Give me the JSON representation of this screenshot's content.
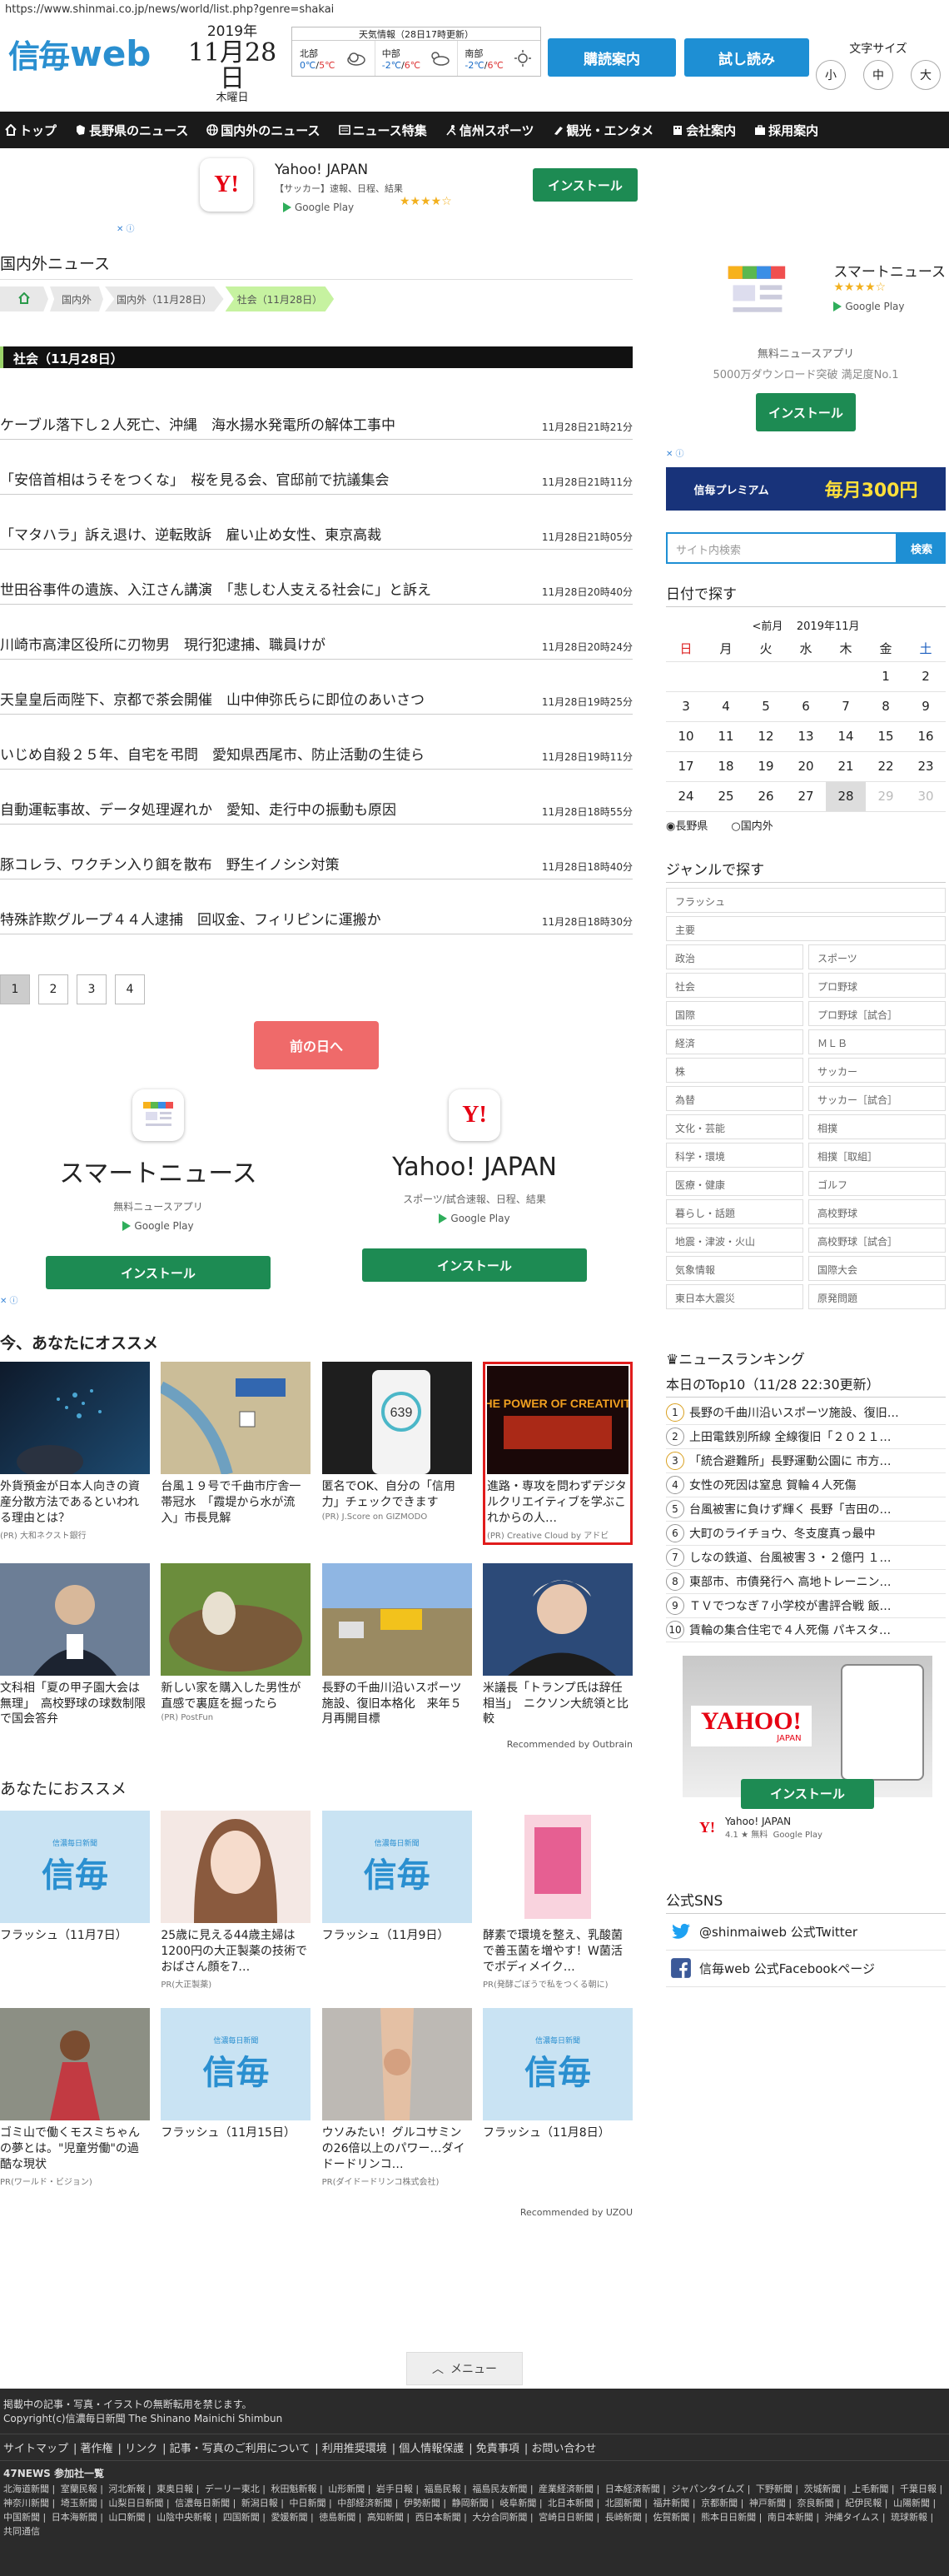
{
  "url": "https://www.shinmai.co.jp/news/world/list.php?genre=shakai",
  "header": {
    "logo_kanji": "信毎",
    "logo_web": "web",
    "year": "2019年",
    "month_day": "11月28日",
    "weekday": "木曜日",
    "weather_title": "天気情報（28日17時更新）",
    "weather": [
      {
        "area": "北部",
        "low": "0℃",
        "high": "5℃",
        "icon": "cloud-icon"
      },
      {
        "area": "中部",
        "low": "-2℃",
        "high": "6℃",
        "icon": "cloud-sun-icon"
      },
      {
        "area": "南部",
        "low": "-2℃",
        "high": "6℃",
        "icon": "sun-icon"
      }
    ],
    "subscribe_label": "購読案内",
    "trial_label": "試し読み",
    "font_size_label": "文字サイズ",
    "font_sizes": [
      "小",
      "中",
      "大"
    ],
    "brand_color": "#2a8fd0"
  },
  "nav": [
    {
      "label": "トップ",
      "icon": "home-icon"
    },
    {
      "label": "長野県のニュース",
      "icon": "map-icon"
    },
    {
      "label": "国内外のニュース",
      "icon": "globe-icon"
    },
    {
      "label": "ニュース特集",
      "icon": "newspaper-icon"
    },
    {
      "label": "信州スポーツ",
      "icon": "sports-icon"
    },
    {
      "label": "観光・エンタメ",
      "icon": "camera-icon"
    },
    {
      "label": "会社案内",
      "icon": "building-icon"
    },
    {
      "label": "採用案内",
      "icon": "briefcase-icon"
    }
  ],
  "top_ad": {
    "brand": "Yahoo! JAPAN",
    "desc": "【サッカー】速報、日程、結果",
    "stars": "★★★★☆",
    "store": "Google Play",
    "install": "インストール"
  },
  "main": {
    "section_title": "国内外ニュース",
    "breadcrumb": [
      "国内外",
      "国内外（11月28日）",
      "社会（11月28日）"
    ],
    "category_title": "社会（11月28日）",
    "news": [
      {
        "title": "ケーブル落下し２人死亡、沖縄　海水揚水発電所の解体工事中",
        "time": "11月28日21時21分"
      },
      {
        "title": "「安倍首相はうそをつくな」　桜を見る会、官邸前で抗議集会",
        "time": "11月28日21時11分"
      },
      {
        "title": "「マタハラ」訴え退け、逆転敗訴　雇い止め女性、東京高裁",
        "time": "11月28日21時05分"
      },
      {
        "title": "世田谷事件の遺族、入江さん講演　「悲しむ人支える社会に」と訴え",
        "time": "11月28日20時40分"
      },
      {
        "title": "川崎市高津区役所に刃物男　現行犯逮捕、職員けが",
        "time": "11月28日20時24分"
      },
      {
        "title": "天皇皇后両陛下、京都で茶会開催　山中伸弥氏らに即位のあいさつ",
        "time": "11月28日19時25分"
      },
      {
        "title": "いじめ自殺２５年、自宅を弔問　愛知県西尾市、防止活動の生徒ら",
        "time": "11月28日19時11分"
      },
      {
        "title": "自動運転事故、データ処理遅れか　愛知、走行中の振動も原因",
        "time": "11月28日18時55分"
      },
      {
        "title": "豚コレラ、ワクチン入り餌を散布　野生イノシシ対策",
        "time": "11月28日18時40分"
      },
      {
        "title": "特殊詐欺グループ４４人逮捕　回収金、フィリピンに運搬か",
        "time": "11月28日18時30分"
      }
    ],
    "pages": [
      "1",
      "2",
      "3",
      "4"
    ],
    "prev_day": "前の日へ",
    "dual_ad": [
      {
        "name": "スマートニュース",
        "sub": "無料ニュースアプリ",
        "store": "Google Play",
        "install": "インストール"
      },
      {
        "name": "Yahoo! JAPAN",
        "sub": "スポーツ/試合速報、日程、結果",
        "store": "Google Play",
        "install": "インストール"
      }
    ],
    "reco_title": "今、あなたにオススメ",
    "reco": [
      {
        "caption": "外貨預金が日本人向きの資産分散方法であるといわれる理由とは？",
        "source": "(PR) 大和ネクスト銀行"
      },
      {
        "caption": "台風１９号で千曲市庁舎一帯冠水　「霞堤から水が流入」市長見解",
        "source": ""
      },
      {
        "caption": "匿名でOK、自分の「信用力」チェックできます",
        "source": "(PR) J.Score on GIZMODO"
      },
      {
        "caption": "進路・専攻を問わずデジタルクリエイティブを学ぶこれからの人…",
        "source": "(PR) Creative Cloud by アドビ"
      },
      {
        "caption": "文科相「夏の甲子園大会は無理」　高校野球の球数制限で国会答弁",
        "source": ""
      },
      {
        "caption": "新しい家を購入した男性が直感で裏庭を掘ったら",
        "source": "(PR) PostFun"
      },
      {
        "caption": "長野の千曲川沿いスポーツ施設、復旧本格化　来年５月再開目標",
        "source": ""
      },
      {
        "caption": "米議長「トランプ氏は辞任相当」　ニクソン大統領と比較",
        "source": ""
      }
    ],
    "reco_banner_text": "THE POWER OF CREATIVITY",
    "reco_by": "Recommended by Outbrain",
    "reco2_title": "あなたにおススメ",
    "reco2": [
      {
        "caption": "フラッシュ（11月7日）",
        "source": "",
        "img": "web"
      },
      {
        "caption": "25歳に見える44歳主婦は1200円の大正製薬の技術でおばさん顔を7…",
        "source": "PR(大正製薬)",
        "img": "woman"
      },
      {
        "caption": "フラッシュ（11月9日）",
        "source": "",
        "img": "web"
      },
      {
        "caption": "酵素で環境を整え、乳酸菌で善玉菌を増やす！W菌活でボディメイク…",
        "source": "PR(発酵ごぼうで私をつくる朝に)",
        "img": "product"
      },
      {
        "caption": "ゴミ山で働くモスミちゃんの夢とは。\"児童労働\"の過酷な現状",
        "source": "PR(ワールド・ビジョン)",
        "img": "child"
      },
      {
        "caption": "フラッシュ（11月15日）",
        "source": "",
        "img": "web"
      },
      {
        "caption": "ウソみたい！グルコサミンの26倍以上のパワー…ダイドードリンコ…",
        "source": "PR(ダイドードリンコ株式会社)",
        "img": "knee"
      },
      {
        "caption": "フラッシュ（11月8日）",
        "source": "",
        "img": "web"
      }
    ],
    "web_sub": "信濃毎日新聞",
    "reco2_by": "Recommended by UZOU",
    "menu_label": "メニュー"
  },
  "side": {
    "app_name": "スマートニュース",
    "app_stars": "★★★★☆",
    "app_store": "Google Play",
    "app_free": "無料ニュースアプリ",
    "app_dl": "5000万ダウンロード突破 満足度No.1",
    "app_install": "インストール",
    "banner_left": "信毎プレミアム",
    "banner_mid": "毎月300円",
    "search_placeholder": "サイト内検索",
    "search_btn": "検索",
    "date_title": "日付で探す",
    "cal_prev": "<前月",
    "cal_month": "2019年11月",
    "cal_week": [
      "日",
      "月",
      "火",
      "水",
      "木",
      "金",
      "土"
    ],
    "cal_rows": [
      [
        "",
        "",
        "",
        "",
        "",
        "1",
        "2"
      ],
      [
        "3",
        "4",
        "5",
        "6",
        "7",
        "8",
        "9"
      ],
      [
        "10",
        "11",
        "12",
        "13",
        "14",
        "15",
        "16"
      ],
      [
        "17",
        "18",
        "19",
        "20",
        "21",
        "22",
        "23"
      ],
      [
        "24",
        "25",
        "26",
        "27",
        "28",
        "29",
        "30"
      ]
    ],
    "radio": [
      "長野県",
      "国内外"
    ],
    "genre_title": "ジャンルで探す",
    "genre_full": [
      "フラッシュ",
      "主要"
    ],
    "genre_pairs": [
      [
        "政治",
        "スポーツ"
      ],
      [
        "社会",
        "プロ野球"
      ],
      [
        "国際",
        "プロ野球［試合］"
      ],
      [
        "経済",
        "ＭＬＢ"
      ],
      [
        "株",
        "サッカー"
      ],
      [
        "為替",
        "サッカー［試合］"
      ],
      [
        "文化・芸能",
        "相撲"
      ],
      [
        "科学・環境",
        "相撲［取組］"
      ],
      [
        "医療・健康",
        "ゴルフ"
      ],
      [
        "暮らし・話題",
        "高校野球"
      ],
      [
        "地震・津波・火山",
        "高校野球［試合］"
      ],
      [
        "気象情報",
        "国際大会"
      ],
      [
        "東日本大震災",
        "原発問題"
      ]
    ],
    "rank_title": "ニュースランキング",
    "rank_sub": "本日のTop10（11/28 22:30更新）",
    "rank": [
      "長野の千曲川沿いスポーツ施設、復旧…",
      "上田電鉄別所線 全線復旧「２０２１…",
      "「統合避難所」長野運動公園に 市方…",
      "女性の死因は窒息 賀輪４人死傷",
      "台風被害に負けず輝く 長野「吉田の…",
      "大町のライチョウ、冬支度真っ最中",
      "しなの鉄道、台風被害３・２億円 １…",
      "東部市、市債発行へ 高地トレーニン…",
      "ＴＶでつなぎ７小学校が書評合戦 飯…",
      "賃輪の集合住宅で４人死傷 パキスタ…"
    ],
    "yahoo_brand": "YAHOO!",
    "yahoo_sub": "JAPAN",
    "yahoo_install": "インストール",
    "yahoo_name": "Yahoo! JAPAN",
    "yahoo_meta": "4.1 ★ 無料",
    "yahoo_store": "Google Play",
    "sns_title": "公式SNS",
    "sns": [
      {
        "label": "@shinmaiweb 公式Twitter",
        "icon": "twitter-icon"
      },
      {
        "label": "信毎web 公式Facebookページ",
        "icon": "facebook-icon"
      }
    ]
  },
  "footer": {
    "notice": "掲載中の記事・写真・イラストの無断転用を禁じます。",
    "copyright": "Copyright(c)信濃毎日新聞 The Shinano Mainichi Shimbun",
    "links": [
      "サイトマップ",
      "著作権",
      "リンク",
      "記事・写真のご利用について",
      "利用推奨環境",
      "個人情報保護",
      "免責事項",
      "お問い合わせ"
    ],
    "h47": "47NEWS 参加社一覧",
    "papers": [
      "北海道新聞",
      "室蘭民報",
      "河北新報",
      "東奥日報",
      "デーリー東北",
      "秋田魁新報",
      "山形新聞",
      "岩手日報",
      "福島民報",
      "福島民友新聞",
      "産業経済新聞",
      "日本経済新聞",
      "ジャパンタイムズ",
      "下野新聞",
      "茨城新聞",
      "上毛新聞",
      "千葉日報",
      "神奈川新聞",
      "埼玉新聞",
      "山梨日日新聞",
      "信濃毎日新聞",
      "新潟日報",
      "中日新聞",
      "中部経済新聞",
      "伊勢新聞",
      "静岡新聞",
      "岐阜新聞",
      "北日本新聞",
      "北國新聞",
      "福井新聞",
      "京都新聞",
      "神戸新聞",
      "奈良新聞",
      "紀伊民報",
      "山陽新聞",
      "中国新聞",
      "日本海新聞",
      "山口新聞",
      "山陰中央新報",
      "四国新聞",
      "愛媛新聞",
      "徳島新聞",
      "高知新聞",
      "西日本新聞",
      "大分合同新聞",
      "宮崎日日新聞",
      "長崎新聞",
      "佐賀新聞",
      "熊本日日新聞",
      "南日本新聞",
      "沖縄タイムス",
      "琉球新報",
      "共同通信"
    ]
  }
}
